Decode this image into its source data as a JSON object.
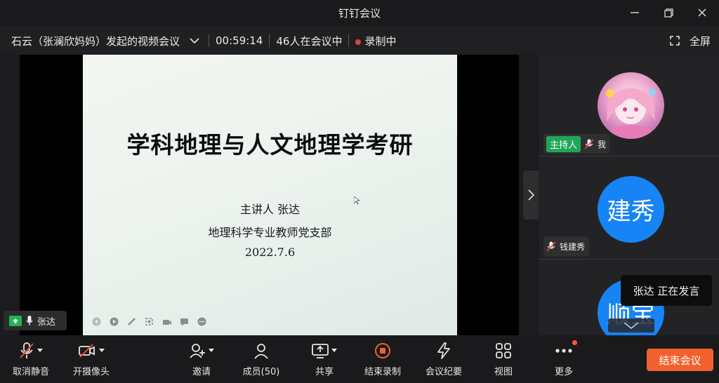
{
  "window": {
    "title": "钉钉会议"
  },
  "info": {
    "meeting_name": "石云（张澜欣妈妈）发起的视频会议",
    "duration": "00:59:14",
    "participants_in_meeting": "46人在会议中",
    "recording": "录制中",
    "fullscreen_label": "全屏"
  },
  "slide": {
    "title": "学科地理与人文地理学考研",
    "lines": [
      "主讲人  张达",
      "地理科学专业教师党支部",
      "2022.7.6"
    ]
  },
  "presenter_tag": {
    "name": "张达"
  },
  "participants": [
    {
      "name": "我",
      "host_label": "主持人",
      "avatar": "photo"
    },
    {
      "name": "钱建秀",
      "avatar_text": "建秀"
    },
    {
      "avatar_text": "顺宝"
    }
  ],
  "speaking_toast": "张达  正在发言",
  "toolbar": {
    "unmute": "取消静音",
    "camera": "开摄像头",
    "invite": "邀请",
    "members": "成员(50)",
    "share": "共享",
    "stop_record": "结束录制",
    "minutes": "会议纪要",
    "view": "视图",
    "more": "更多",
    "end_meeting": "结束会议"
  },
  "colors": {
    "accent": "#f2612d",
    "avatar_blue": "#1784f5",
    "host_green": "#1fa55a",
    "record_red": "#e0423b"
  }
}
